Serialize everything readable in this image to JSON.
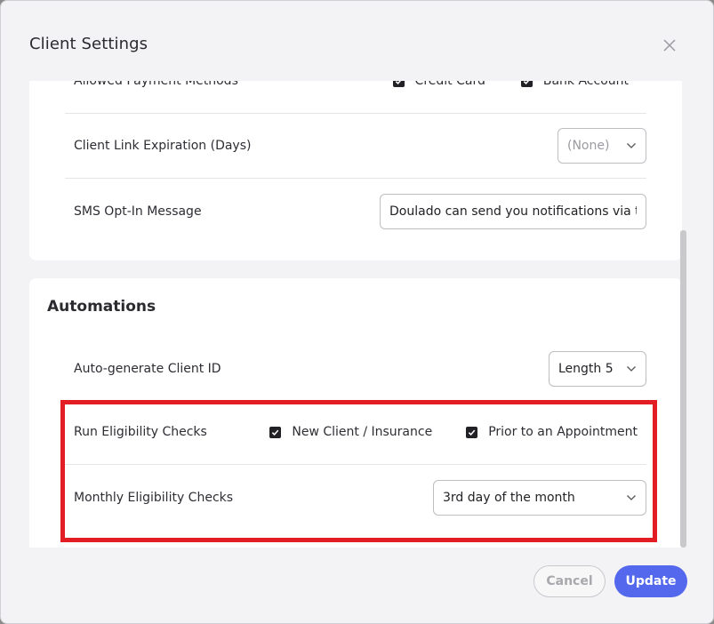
{
  "modal": {
    "title": "Client Settings"
  },
  "settings": {
    "payment_methods": {
      "label": "Allowed Payment Methods",
      "options": [
        {
          "label": "Credit Card",
          "checked": true
        },
        {
          "label": "Bank Account",
          "checked": true
        }
      ]
    },
    "link_expiration": {
      "label": "Client Link Expiration (Days)",
      "value": "(None)"
    },
    "sms_opt_in": {
      "label": "SMS Opt-In Message",
      "value": "Doulado can send you notifications via text."
    }
  },
  "automations": {
    "title": "Automations",
    "client_id": {
      "label": "Auto-generate Client ID",
      "value": "Length 5"
    },
    "eligibility_checks": {
      "label": "Run Eligibility Checks",
      "options": [
        {
          "label": "New Client / Insurance",
          "checked": true
        },
        {
          "label": "Prior to an Appointment",
          "checked": true
        }
      ]
    },
    "monthly_checks": {
      "label": "Monthly Eligibility Checks",
      "value": "3rd day of the month"
    }
  },
  "footer": {
    "cancel_label": "Cancel",
    "update_label": "Update"
  },
  "colors": {
    "primary": "#5468ee",
    "highlight": "#e21d24"
  },
  "icons": {
    "close": "close-icon",
    "chevron": "chevron-down-icon",
    "check": "checkmark-icon"
  }
}
